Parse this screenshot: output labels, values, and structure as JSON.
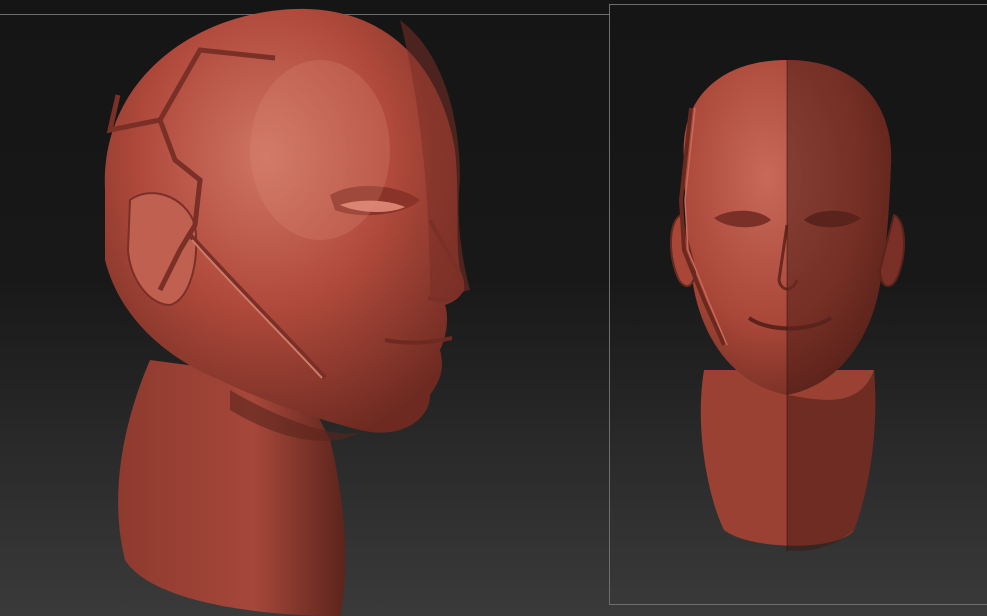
{
  "scene": {
    "material_color": "#b5483a",
    "shadow_color": "#5a241d",
    "highlight_color": "#e08a78",
    "background_top": "#151515",
    "background_bottom": "#3a3a3a"
  },
  "viewports": [
    {
      "name": "three-quarter-view",
      "subject": "sculpted-head"
    },
    {
      "name": "front-view",
      "subject": "sculpted-head"
    }
  ]
}
